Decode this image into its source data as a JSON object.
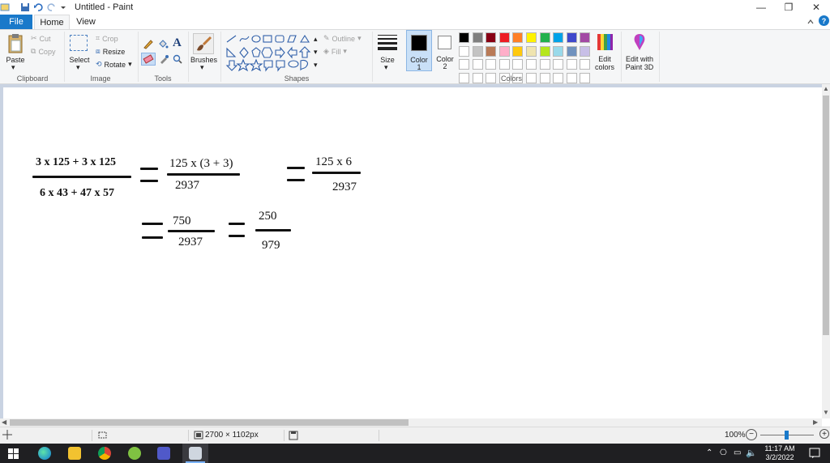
{
  "window": {
    "title": "Untitled - Paint",
    "minimize_glyph": "—",
    "restore_glyph": "❐",
    "close_glyph": "✕"
  },
  "tabs": {
    "file": "File",
    "home": "Home",
    "view": "View"
  },
  "ribbon": {
    "clipboard": {
      "label": "Clipboard",
      "paste": "Paste",
      "cut": "Cut",
      "copy": "Copy"
    },
    "image": {
      "label": "Image",
      "select": "Select",
      "crop": "Crop",
      "resize": "Resize",
      "rotate": "Rotate"
    },
    "tools": {
      "label": "Tools"
    },
    "brushes": {
      "label": "Brushes"
    },
    "shapes": {
      "label": "Shapes",
      "outline": "Outline",
      "fill": "Fill"
    },
    "size": {
      "label": "Size"
    },
    "color1": {
      "label": "Color",
      "num": "1"
    },
    "color2": {
      "label": "Color",
      "num": "2"
    },
    "colors": {
      "label": "Colors"
    },
    "edit_colors": {
      "line1": "Edit",
      "line2": "colors"
    },
    "paint3d": {
      "line1": "Edit with",
      "line2": "Paint 3D"
    },
    "palette_row1": [
      "#000000",
      "#7f7f7f",
      "#880015",
      "#ed1c24",
      "#ff7f27",
      "#fff200",
      "#22b14c",
      "#00a2e8",
      "#3f48cc",
      "#a349a4"
    ],
    "palette_row2": [
      "#ffffff",
      "#c3c3c3",
      "#b97a57",
      "#ffaec9",
      "#ffc90e",
      "#efe4b0",
      "#b5e61d",
      "#99d9ea",
      "#7092be",
      "#c8bfe7"
    ],
    "active_color1": "#000000",
    "active_color2": "#ffffff"
  },
  "canvas": {
    "expr1_num": "3 x 125 + 3 x 125",
    "expr1_den": "6 x 43 + 47 x 57",
    "expr2_num": "125 x (3 + 3)",
    "expr2_den": "2937",
    "expr3_num": "125 x 6",
    "expr3_den": "2937",
    "expr4_num": "750",
    "expr4_den": "2937",
    "expr5_num": "250",
    "expr5_den": "979"
  },
  "status": {
    "dimensions": "2700 × 1102px",
    "zoom": "100%",
    "zoom_out": "−",
    "zoom_in": "+"
  },
  "taskbar": {
    "time": "11:17 AM",
    "date": "3/2/2022"
  }
}
